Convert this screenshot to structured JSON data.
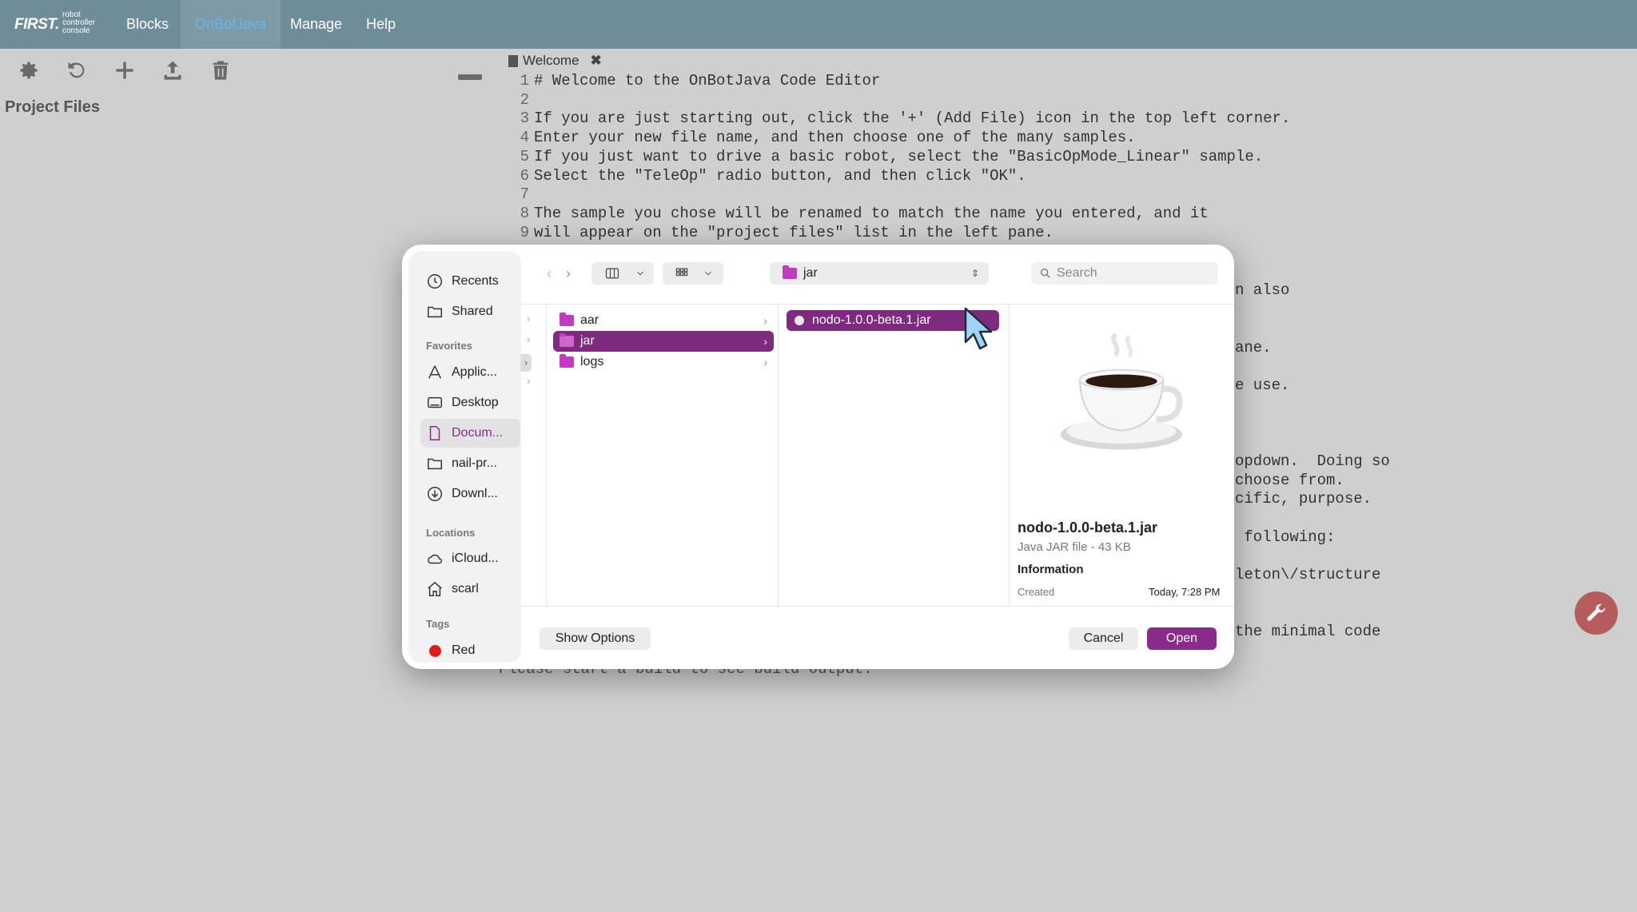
{
  "nav": {
    "logo_main": "FIRST.",
    "logo_sub": "robot controller console",
    "items": [
      {
        "label": "Blocks"
      },
      {
        "label": "OnBotJava"
      },
      {
        "label": "Manage"
      },
      {
        "label": "Help"
      }
    ],
    "active_item": "OnBotJava"
  },
  "toolbar": {
    "icons": [
      "gear-icon",
      "undo-icon",
      "plus-icon",
      "upload-icon",
      "trash-icon"
    ]
  },
  "left_pane": {
    "title": "Project Files"
  },
  "editor": {
    "tab_label": "Welcome",
    "lines": [
      {
        "n": "1",
        "text": "# Welcome to the OnBotJava Code Editor"
      },
      {
        "n": "2",
        "text": ""
      },
      {
        "n": "3",
        "text": "If you are just starting out, click the '+' (Add File) icon in the top left corner."
      },
      {
        "n": "4",
        "text": "Enter your new file name, and then choose one of the many samples."
      },
      {
        "n": "5",
        "text": "If you just want to drive a basic robot, select the \"BasicOpMode_Linear\" sample."
      },
      {
        "n": "6",
        "text": "Select the \"TeleOp\" radio button, and then click \"OK\"."
      },
      {
        "n": "7",
        "text": ""
      },
      {
        "n": "8",
        "text": "The sample you chose will be renamed to match the name you entered, and it"
      },
      {
        "n": "9",
        "text": "will appear on the \"project files\" list in the left pane."
      }
    ],
    "obscured_fragments": {
      "f1": "n also",
      "f2": "ane.",
      "f3": "e use.",
      "f4": "opdown.  Doing so",
      "f5": "choose from.",
      "f6": "cific, purpose.",
      "f7": " following:",
      "f8": "leton\\/structure",
      "f9": "the minimal code"
    },
    "build_output": "Please start a build to see build output."
  },
  "dialog": {
    "sidebar": {
      "recents": "Recents",
      "shared": "Shared",
      "favorites_heading": "Favorites",
      "favorites": [
        "Applic...",
        "Desktop",
        "Docum...",
        "nail-pr...",
        "Downl..."
      ],
      "selected_favorite": "Docum...",
      "locations_heading": "Locations",
      "locations": [
        "iCloud...",
        "scarl"
      ],
      "tags_heading": "Tags",
      "tags": [
        {
          "label": "Red",
          "color": "#e01b1b"
        }
      ]
    },
    "path_label": "jar",
    "search_placeholder": "Search",
    "column1": [
      {
        "name": "aar"
      },
      {
        "name": "jar"
      },
      {
        "name": "logs"
      }
    ],
    "column1_selected": "jar",
    "column2": [
      {
        "name": "nodo-1.0.0-beta.1.jar"
      }
    ],
    "preview": {
      "name": "nodo-1.0.0-beta.1.jar",
      "kind": "Java JAR file - 43 KB",
      "info_heading": "Information",
      "created_label": "Created",
      "created_value": "Today, 7:28 PM"
    },
    "buttons": {
      "options": "Show Options",
      "cancel": "Cancel",
      "open": "Open"
    },
    "accent_color": "#8a2a8a"
  }
}
